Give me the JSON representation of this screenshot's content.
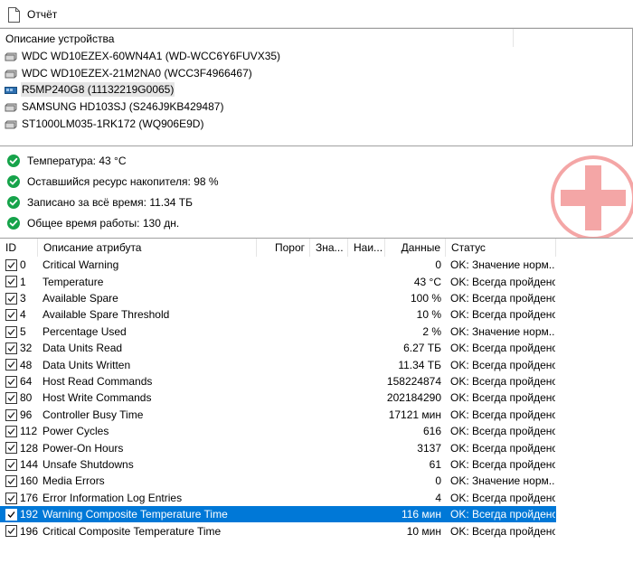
{
  "toolbar": {
    "report_label": "Отчёт",
    "report_icon": "document-icon"
  },
  "devices": {
    "header": "Описание устройства",
    "items": [
      {
        "label": "WDC WD10EZEX-60WN4A1 (WD-WCC6Y6FUVX35)",
        "icon": "hdd-icon",
        "selected": false
      },
      {
        "label": "WDC WD10EZEX-21M2NA0 (WCC3F4966467)",
        "icon": "hdd-icon",
        "selected": false
      },
      {
        "label": "R5MP240G8 (11132219G0065)",
        "icon": "nvme-icon",
        "selected": true
      },
      {
        "label": "SAMSUNG HD103SJ (S246J9KB429487)",
        "icon": "hdd-icon",
        "selected": false
      },
      {
        "label": "ST1000LM035-1RK172 (WQ906E9D)",
        "icon": "hdd-icon",
        "selected": false
      }
    ]
  },
  "status": {
    "lines": [
      "Температура: 43 °C",
      "Оставшийся ресурс накопителя: 98 %",
      "Записано за всё время: 11.34 ТБ",
      "Общее время работы: 130 дн."
    ],
    "ok_color": "#16a34a",
    "health_color": "#e03131"
  },
  "table": {
    "columns": {
      "id": "ID",
      "description": "Описание атрибута",
      "threshold": "Порог",
      "value": "Зна...",
      "worst": "Наи...",
      "data": "Данные",
      "status": "Статус"
    },
    "rows": [
      {
        "id": "0",
        "name": "Critical Warning",
        "data": "0",
        "status": "OK: Значение норм...",
        "checked": true,
        "selected": false
      },
      {
        "id": "1",
        "name": "Temperature",
        "data": "43 °C",
        "status": "OK: Всегда пройдено",
        "checked": true,
        "selected": false
      },
      {
        "id": "3",
        "name": "Available Spare",
        "data": "100 %",
        "status": "OK: Всегда пройдено",
        "checked": true,
        "selected": false
      },
      {
        "id": "4",
        "name": "Available Spare Threshold",
        "data": "10 %",
        "status": "OK: Всегда пройдено",
        "checked": true,
        "selected": false
      },
      {
        "id": "5",
        "name": "Percentage Used",
        "data": "2 %",
        "status": "OK: Значение норм...",
        "checked": true,
        "selected": false
      },
      {
        "id": "32",
        "name": "Data Units Read",
        "data": "6.27 ТБ",
        "status": "OK: Всегда пройдено",
        "checked": true,
        "selected": false
      },
      {
        "id": "48",
        "name": "Data Units Written",
        "data": "11.34 ТБ",
        "status": "OK: Всегда пройдено",
        "checked": true,
        "selected": false
      },
      {
        "id": "64",
        "name": "Host Read Commands",
        "data": "158224874",
        "status": "OK: Всегда пройдено",
        "checked": true,
        "selected": false
      },
      {
        "id": "80",
        "name": "Host Write Commands",
        "data": "202184290",
        "status": "OK: Всегда пройдено",
        "checked": true,
        "selected": false
      },
      {
        "id": "96",
        "name": "Controller Busy Time",
        "data": "17121 мин",
        "status": "OK: Всегда пройдено",
        "checked": true,
        "selected": false
      },
      {
        "id": "112",
        "name": "Power Cycles",
        "data": "616",
        "status": "OK: Всегда пройдено",
        "checked": true,
        "selected": false
      },
      {
        "id": "128",
        "name": "Power-On Hours",
        "data": "3137",
        "status": "OK: Всегда пройдено",
        "checked": true,
        "selected": false
      },
      {
        "id": "144",
        "name": "Unsafe Shutdowns",
        "data": "61",
        "status": "OK: Всегда пройдено",
        "checked": true,
        "selected": false
      },
      {
        "id": "160",
        "name": "Media Errors",
        "data": "0",
        "status": "OK: Значение норм...",
        "checked": true,
        "selected": false
      },
      {
        "id": "176",
        "name": "Error Information Log Entries",
        "data": "4",
        "status": "OK: Всегда пройдено",
        "checked": true,
        "selected": false
      },
      {
        "id": "192",
        "name": "Warning Composite Temperature Time",
        "data": "116 мин",
        "status": "OK: Всегда пройдено",
        "checked": true,
        "selected": true
      },
      {
        "id": "196",
        "name": "Critical Composite Temperature Time",
        "data": "10 мин",
        "status": "OK: Всегда пройдено",
        "checked": true,
        "selected": false
      }
    ]
  }
}
